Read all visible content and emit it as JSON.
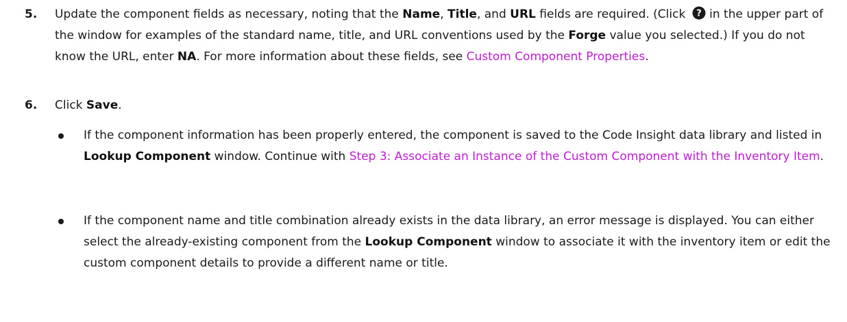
{
  "step5": {
    "number": "5.",
    "t1": "Update the component fields as necessary, noting that the ",
    "name": "Name",
    "t2": ", ",
    "title": "Title",
    "t3": ", and ",
    "url": "URL",
    "t4": " fields are required. (Click ",
    "help_icon": "help-question-icon",
    "t5": " in the upper part of the window for examples of the standard name, title, and URL conventions used by the ",
    "forge": "Forge",
    "t6": " value you selected.) If you do not know the URL, enter ",
    "na": "NA",
    "t7": ". For more information about these fields, see ",
    "link": "Custom Component Properties",
    "t8": "."
  },
  "step6": {
    "number": "6.",
    "t1": "Click ",
    "save": "Save",
    "t2": "."
  },
  "bullets": [
    {
      "t1": "If the component information has been properly entered, the component is saved to the Code Insight data library and listed in ",
      "bold": "Lookup Component",
      "t2": " window. Continue with ",
      "link": "Step 3: Associate an Instance of the Custom Component with the Inventory Item",
      "t3": "."
    },
    {
      "t1": "If the component name and title combination already exists in the data library, an error message is displayed. You can either select the already-existing component from the ",
      "bold": "Lookup Component",
      "t2": " window to associate it with the inventory item or edit the custom component details to provide a different name or title."
    }
  ],
  "colors": {
    "text": "#1a1a1a",
    "link": "#c11bd6"
  }
}
